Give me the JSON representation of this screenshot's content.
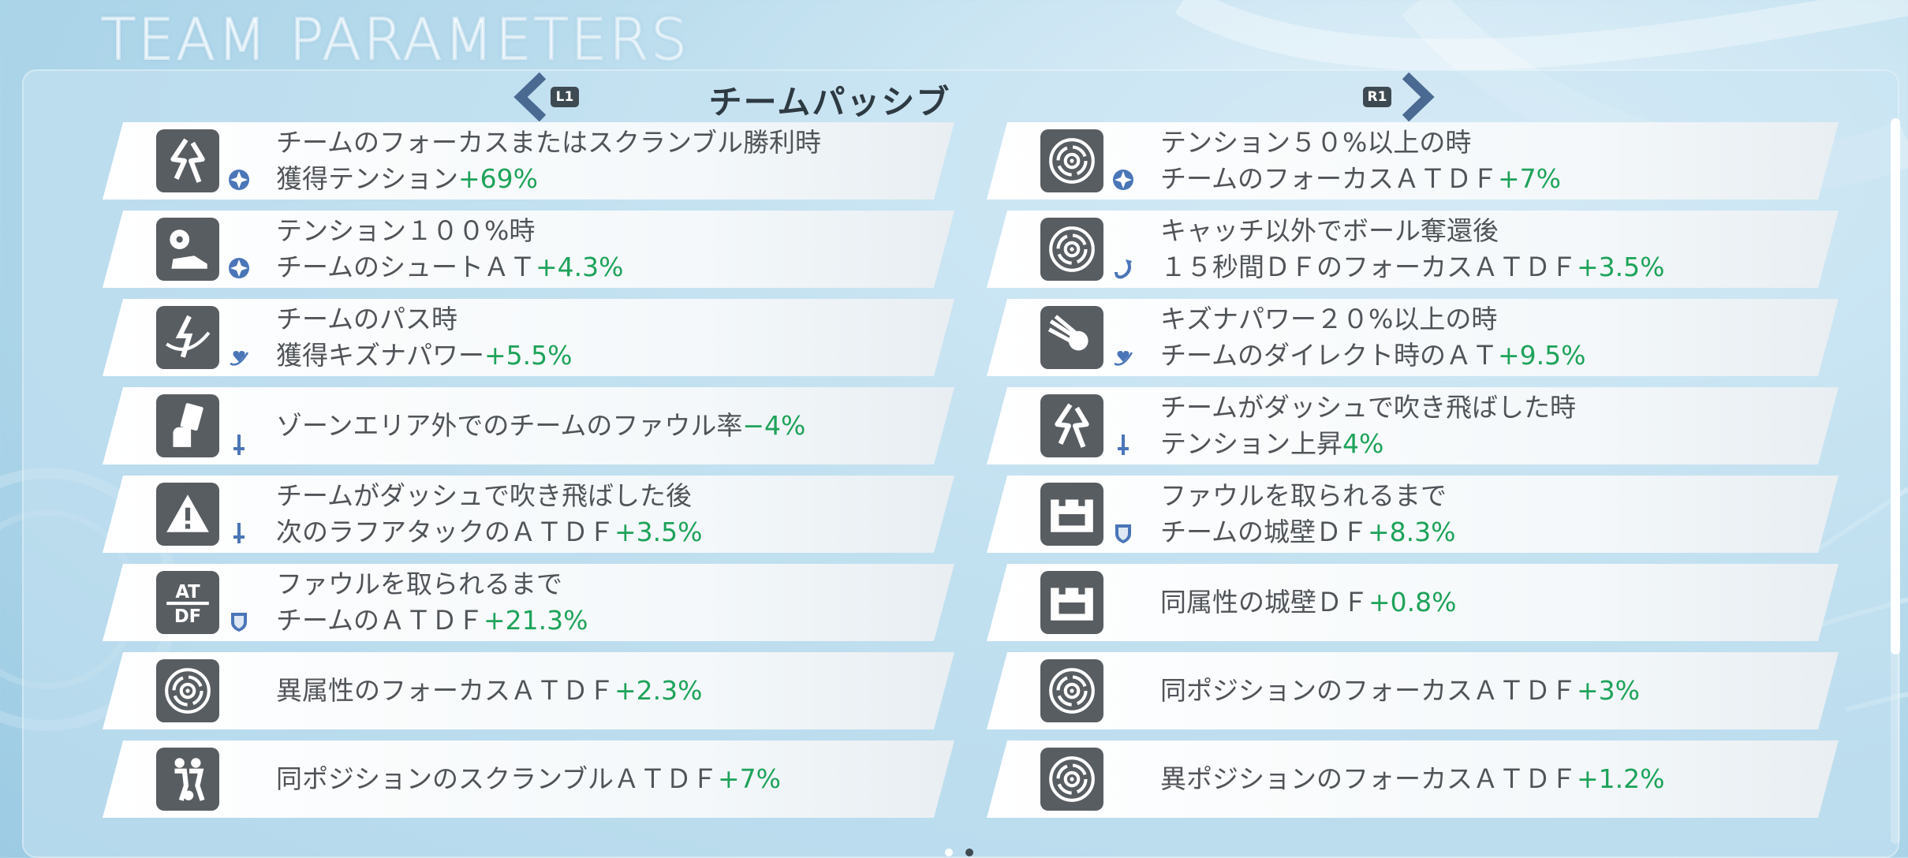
{
  "title": "TEAM PARAMETERS",
  "section_title": "チームパッシブ",
  "nav": {
    "left_button": "L1",
    "right_button": "R1"
  },
  "colors": {
    "value_green": "#1ea35a",
    "icon_bg": "#585d62",
    "sub_icon_blue": "#4a76b8"
  },
  "left_cards": [
    {
      "icon": "lightning-icon",
      "sub_icon": "star-badge-icon",
      "line1": "チームのフォーカスまたはスクランブル勝利時",
      "line2": "獲得テンション",
      "value": "+69%"
    },
    {
      "icon": "soccer-shoot-icon",
      "sub_icon": "star-badge-icon",
      "line1": "テンション１００%時",
      "line2": "チームのシュートＡＴ",
      "value": "+4.3%"
    },
    {
      "icon": "pass-lightning-icon",
      "sub_icon": "heart-wave-icon",
      "line1": "チームのパス時",
      "line2": "獲得キズナパワー",
      "value": "+5.5%"
    },
    {
      "icon": "card-hand-icon",
      "sub_icon": "sword-icon",
      "line1": "ゾーンエリア外でのチームのファウル率",
      "line2": "",
      "value": "−4%"
    },
    {
      "icon": "warning-icon",
      "sub_icon": "sword-icon",
      "line1": "チームがダッシュで吹き飛ばした後",
      "line2": "次のラフアタックのＡＴＤＦ",
      "value": "+3.5%"
    },
    {
      "icon": "at-df-icon",
      "sub_icon": "shield-icon",
      "line1": "ファウルを取られるまで",
      "line2": "チームのＡＴＤＦ",
      "value": "+21.3%"
    },
    {
      "icon": "target-icon",
      "sub_icon": "",
      "line1": "異属性のフォーカスＡＴＤＦ",
      "line2": "",
      "value": "+2.3%"
    },
    {
      "icon": "scramble-players-icon",
      "sub_icon": "",
      "line1": "同ポジションのスクランブルＡＴＤＦ",
      "line2": "",
      "value": "+7%"
    }
  ],
  "right_cards": [
    {
      "icon": "target-icon",
      "sub_icon": "star-badge-icon",
      "line1": "テンション５０%以上の時",
      "line2": "チームのフォーカスＡＴＤＦ",
      "value": "+7%"
    },
    {
      "icon": "target-icon",
      "sub_icon": "recover-arrow-icon",
      "line1": "キャッチ以外でボール奪還後",
      "line2": "１５秒間ＤＦのフォーカスＡＴＤＦ",
      "value": "+3.5%"
    },
    {
      "icon": "comet-icon",
      "sub_icon": "heart-wave-icon",
      "line1": "キズナパワー２０%以上の時",
      "line2": "チームのダイレクト時のＡＴ",
      "value": "+9.5%"
    },
    {
      "icon": "lightning-icon",
      "sub_icon": "sword-icon",
      "line1": "チームがダッシュで吹き飛ばした時",
      "line2": "テンション上昇",
      "value": "4%"
    },
    {
      "icon": "castle-wall-icon",
      "sub_icon": "shield-icon",
      "line1": "ファウルを取られるまで",
      "line2": "チームの城壁ＤＦ",
      "value": "+8.3%"
    },
    {
      "icon": "castle-wall-icon",
      "sub_icon": "",
      "line1": "同属性の城壁ＤＦ",
      "line2": "",
      "value": "+0.8%"
    },
    {
      "icon": "target-icon",
      "sub_icon": "",
      "line1": "同ポジションのフォーカスＡＴＤＦ",
      "line2": "",
      "value": "+3%"
    },
    {
      "icon": "target-icon",
      "sub_icon": "",
      "line1": "異ポジションのフォーカスＡＴＤＦ",
      "line2": "",
      "value": "+1.2%"
    }
  ]
}
